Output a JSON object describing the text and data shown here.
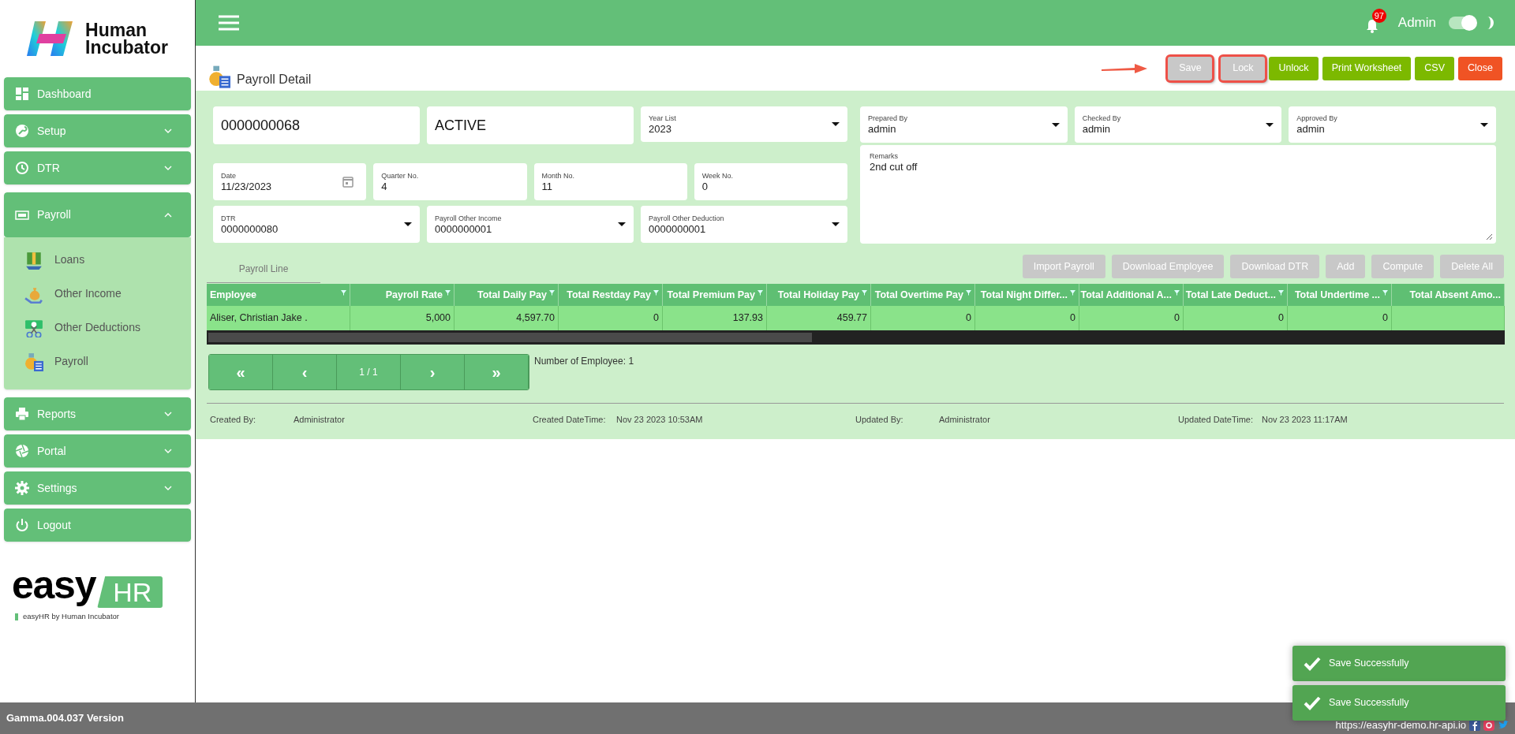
{
  "sidebar": {
    "logo": {
      "line1": "Human",
      "line2": "Incubator"
    },
    "items": [
      {
        "label": "Dashboard",
        "kind": "link"
      },
      {
        "label": "Setup",
        "kind": "group",
        "expanded": false
      },
      {
        "label": "DTR",
        "kind": "group",
        "expanded": false
      },
      {
        "label": "Payroll",
        "kind": "group",
        "expanded": true,
        "children": [
          {
            "label": "Loans"
          },
          {
            "label": "Other Income"
          },
          {
            "label": "Other Deductions"
          },
          {
            "label": "Payroll"
          }
        ]
      },
      {
        "label": "Reports",
        "kind": "group",
        "expanded": false
      },
      {
        "label": "Portal",
        "kind": "group",
        "expanded": false
      },
      {
        "label": "Settings",
        "kind": "group",
        "expanded": false
      },
      {
        "label": "Logout",
        "kind": "link"
      }
    ],
    "brand": {
      "word": "easy",
      "badge": "HR",
      "tagline": "easyHR by Human Incubator"
    }
  },
  "header": {
    "notifications": "97",
    "user": "Admin",
    "theme_toggle": {
      "on": true
    }
  },
  "page": {
    "title": "Payroll Detail",
    "actions": [
      {
        "label": "Save",
        "kind": "normal",
        "disabled": true,
        "highlighted": true
      },
      {
        "label": "Lock",
        "kind": "normal",
        "disabled": true,
        "highlighted": true
      },
      {
        "label": "Unlock",
        "kind": "normal",
        "disabled": false,
        "highlighted": false
      },
      {
        "label": "Print Worksheet",
        "kind": "normal",
        "disabled": false,
        "highlighted": false
      },
      {
        "label": "CSV",
        "kind": "normal",
        "disabled": false,
        "highlighted": false
      },
      {
        "label": "Close",
        "kind": "danger",
        "disabled": false,
        "highlighted": false
      }
    ]
  },
  "form": {
    "top": [
      {
        "kind": "plain",
        "value": "0000000068"
      },
      {
        "kind": "plain",
        "value": "ACTIVE"
      },
      {
        "kind": "select",
        "label": "Year List",
        "value": "2023"
      }
    ],
    "period": [
      {
        "kind": "date",
        "label": "Date",
        "value": "11/23/2023"
      },
      {
        "kind": "text",
        "label": "Quarter No.",
        "value": "4"
      },
      {
        "kind": "text",
        "label": "Month No.",
        "value": "11"
      },
      {
        "kind": "text",
        "label": "Week No.",
        "value": "0"
      }
    ],
    "links": [
      {
        "kind": "select",
        "label": "DTR",
        "value": "0000000080"
      },
      {
        "kind": "select",
        "label": "Payroll Other Income",
        "value": "0000000001"
      },
      {
        "kind": "select",
        "label": "Payroll Other Deduction",
        "value": "0000000001"
      }
    ],
    "signatories": [
      {
        "kind": "select",
        "label": "Prepared By",
        "value": "admin"
      },
      {
        "kind": "select",
        "label": "Checked By",
        "value": "admin"
      },
      {
        "kind": "select",
        "label": "Approved By",
        "value": "admin"
      }
    ],
    "remarks": {
      "label": "Remarks",
      "value": "2nd cut off"
    }
  },
  "tabs": [
    {
      "label": "Payroll Line",
      "selected": true
    }
  ],
  "line_actions": [
    {
      "label": "Import Payroll",
      "disabled": true
    },
    {
      "label": "Download Employee",
      "disabled": true
    },
    {
      "label": "Download DTR",
      "disabled": true
    },
    {
      "label": "Add",
      "disabled": true
    },
    {
      "label": "Compute",
      "disabled": true
    },
    {
      "label": "Delete All",
      "disabled": true
    }
  ],
  "table": {
    "columns": [
      {
        "label": "Employee",
        "kind": "text"
      },
      {
        "label": "Payroll Rate",
        "kind": "number"
      },
      {
        "label": "Total Daily Pay",
        "kind": "number"
      },
      {
        "label": "Total Restday Pay",
        "kind": "number"
      },
      {
        "label": "Total Premium Pay",
        "kind": "number"
      },
      {
        "label": "Total Holiday Pay",
        "kind": "number"
      },
      {
        "label": "Total Overtime Pay",
        "kind": "number"
      },
      {
        "label": "Total Night Differ...",
        "kind": "number"
      },
      {
        "label": "Total Additional A...",
        "kind": "number"
      },
      {
        "label": "Total Late Deduct...",
        "kind": "number"
      },
      {
        "label": "Total Undertime ...",
        "kind": "number"
      },
      {
        "label": "Total Absent Amo...",
        "kind": "number"
      }
    ],
    "rows": [
      [
        "Aliser, Christian Jake .",
        "5,000",
        "4,597.70",
        "0",
        "137.93",
        "459.77",
        "0",
        "0",
        "0",
        "0",
        "0",
        null
      ]
    ]
  },
  "pagination": {
    "buttons": [
      "«",
      "‹",
      "1 / 1",
      "›",
      "»"
    ],
    "summary": "Number of Employee: 1"
  },
  "audit": [
    {
      "label": "Created By:",
      "value": "Administrator"
    },
    {
      "label": "Created DateTime:",
      "value": "Nov 23 2023 10:53AM"
    },
    {
      "label": "Updated By:",
      "value": "Administrator"
    },
    {
      "label": "Updated DateTime:",
      "value": "Nov 23 2023 11:17AM"
    }
  ],
  "toasts": [
    {
      "message": "Save Successfully"
    },
    {
      "message": "Save Successfully"
    }
  ],
  "footer": {
    "version": "Gamma.004.037 Version",
    "url": "https://easyhr-demo.hr-api.io"
  }
}
